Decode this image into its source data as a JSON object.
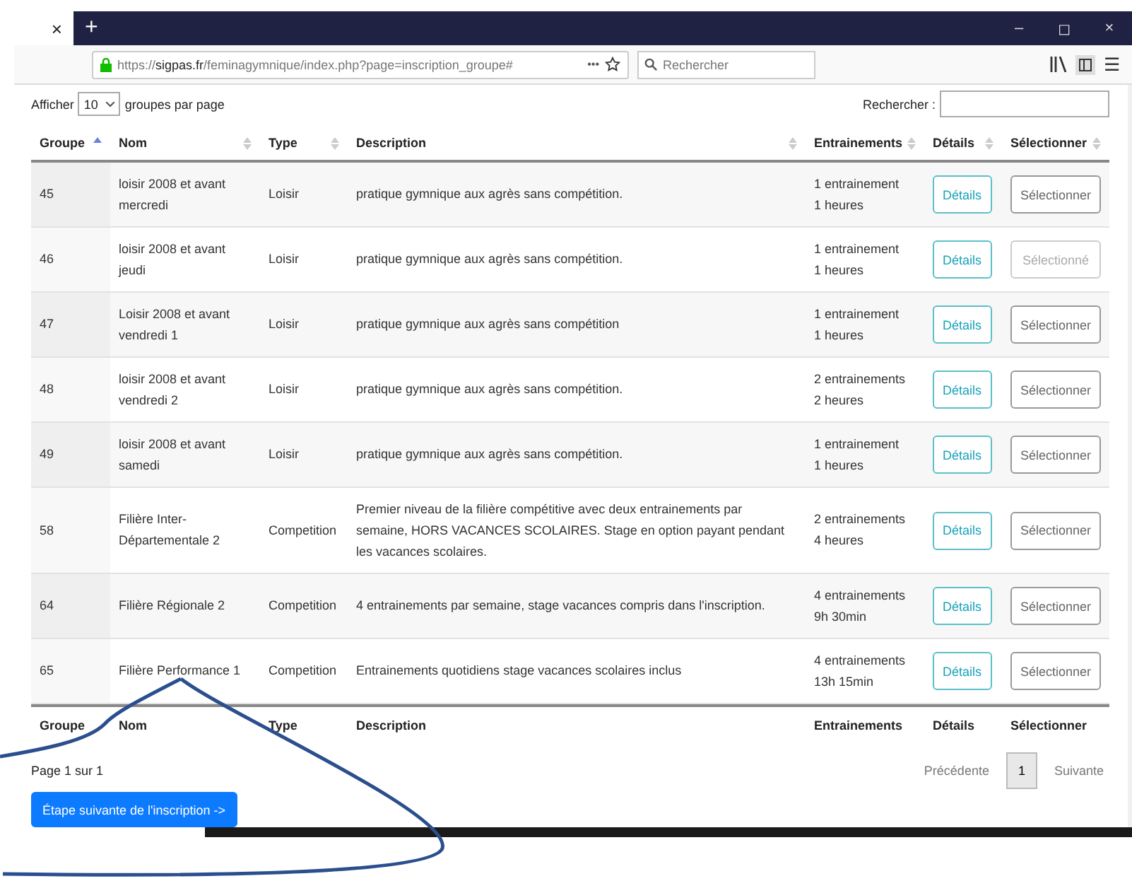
{
  "browser": {
    "tab_close": "×",
    "new_tab": "+",
    "window_controls": [
      "–",
      "◻",
      "×"
    ],
    "url": "https://**sigpas.fr**/feminagymnique/index.php?page=inscription_groupe#",
    "more": "•••",
    "search_placeholder": "Rechercher",
    "menu": "☰"
  },
  "length": {
    "before": "Afficher",
    "value": "10",
    "after": "groupes par page"
  },
  "search": {
    "label": "Rechercher :"
  },
  "table": {
    "columns": [
      {
        "label": "Groupe",
        "sorted": true
      },
      {
        "label": "Nom",
        "sorted": false
      },
      {
        "label": "Type",
        "sorted": false
      },
      {
        "label": "Description",
        "sorted": false
      },
      {
        "label": "Entrainements",
        "sorted": false
      },
      {
        "label": "Détails",
        "sorted": false
      },
      {
        "label": "Sélectionner",
        "sorted": false
      }
    ],
    "rows": [
      {
        "group": "45",
        "name": "loisir 2008 et avant mercredi",
        "type": "Loisir",
        "description": "pratique gymnique aux agrès sans compétition.",
        "sessions": "1 entrainement",
        "hours": "1 heures",
        "details": "Détails",
        "select": "Sélectionner",
        "selected": false
      },
      {
        "group": "46",
        "name": "loisir 2008 et avant jeudi",
        "type": "Loisir",
        "description": "pratique gymnique aux agrès sans compétition.",
        "sessions": "1 entrainement",
        "hours": "1 heures",
        "details": "Détails",
        "select": "Sélectionné",
        "selected": true
      },
      {
        "group": "47",
        "name": "Loisir 2008 et avant vendredi 1",
        "type": "Loisir",
        "description": "pratique gymnique aux agrès sans compétition",
        "sessions": "1 entrainement",
        "hours": "1 heures",
        "details": "Détails",
        "select": "Sélectionner",
        "selected": false
      },
      {
        "group": "48",
        "name": "loisir 2008 et avant vendredi 2",
        "type": "Loisir",
        "description": "pratique gymnique aux agrès sans compétition.",
        "sessions": "2 entrainements",
        "hours": "2 heures",
        "details": "Détails",
        "select": "Sélectionner",
        "selected": false
      },
      {
        "group": "49",
        "name": "loisir 2008 et avant samedi",
        "type": "Loisir",
        "description": "pratique gymnique aux agrès sans compétition.",
        "sessions": "1 entrainement",
        "hours": "1 heures",
        "details": "Détails",
        "select": "Sélectionner",
        "selected": false
      },
      {
        "group": "58",
        "name": "Filière Inter-Départementale 2",
        "type": "Competition",
        "description": "Premier niveau de la filière compétitive avec deux entrainements par semaine, HORS VACANCES SCOLAIRES. Stage en option payant pendant les vacances scolaires.",
        "sessions": "2 entrainements",
        "hours": "4 heures",
        "details": "Détails",
        "select": "Sélectionner",
        "selected": false
      },
      {
        "group": "64",
        "name": "Filière Régionale 2",
        "type": "Competition",
        "description": "4 entrainements par semaine, stage vacances compris dans l'inscription.",
        "sessions": "4 entrainements",
        "hours": "9h 30min",
        "details": "Détails",
        "select": "Sélectionner",
        "selected": false
      },
      {
        "group": "65",
        "name": "Filière Performance 1",
        "type": "Competition",
        "description": "Entrainements quotidiens stage vacances scolaires inclus",
        "sessions": "4 entrainements",
        "hours": "13h 15min",
        "details": "Détails",
        "select": "Sélectionner",
        "selected": false
      }
    ],
    "footer": [
      "Groupe",
      "Nom",
      "Type",
      "Description",
      "Entrainements",
      "Détails",
      "Sélectionner"
    ]
  },
  "pagination": {
    "info": "Page 1 sur 1",
    "previous": "Précédente",
    "pages": [
      {
        "label": "1",
        "selected": true
      }
    ],
    "next": "Suivante"
  },
  "next_step": "Étape suivante de l'inscription ->"
}
